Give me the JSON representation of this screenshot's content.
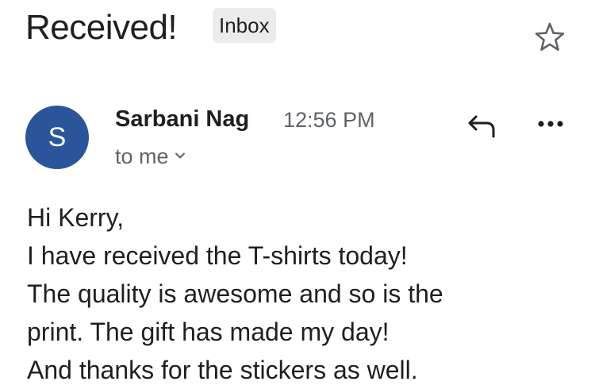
{
  "email": {
    "subject": "Received!",
    "label": "Inbox"
  },
  "sender": {
    "initial": "S",
    "name": "Sarbani Nag",
    "time": "12:56 PM",
    "recipients_label": "to me",
    "avatar_color": "#2b559a"
  },
  "icons": {
    "star": "star-outline-icon",
    "reply": "reply-arrow-icon",
    "more": "more-horizontal-icon",
    "recipients_toggle": "chevron-down-icon"
  },
  "body": {
    "lines": [
      "Hi Kerry,",
      "I have received the T-shirts today!",
      "The quality is awesome and so is the",
      "print. The gift has made my day!",
      "And thanks for the stickers as well."
    ]
  }
}
